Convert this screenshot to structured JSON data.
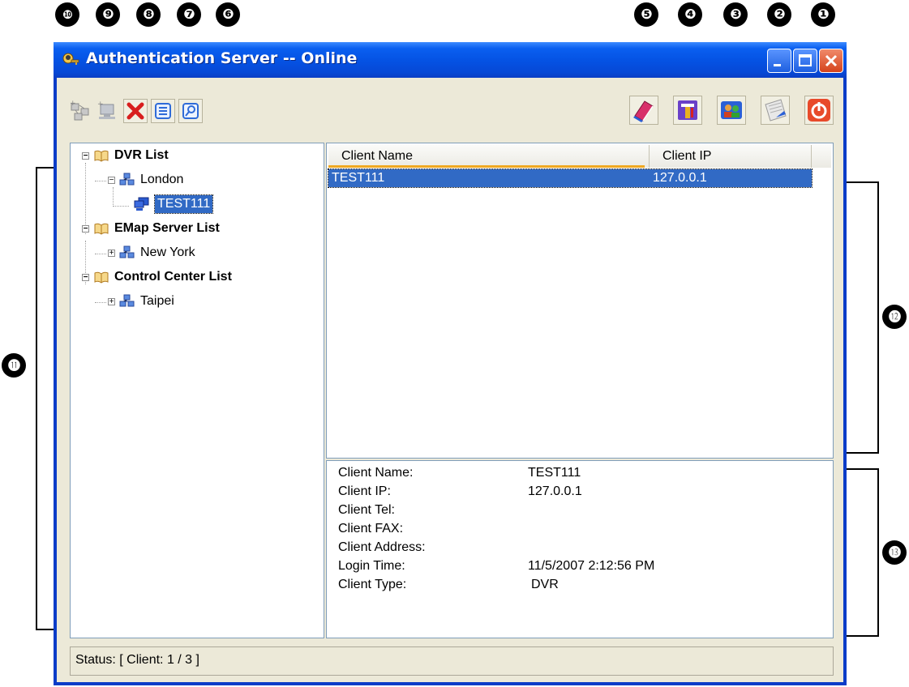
{
  "callouts": {
    "c1": "❶",
    "c2": "❷",
    "c3": "❸",
    "c4": "❹",
    "c5": "❺",
    "c6": "❻",
    "c7": "❼",
    "c8": "❽",
    "c9": "❾",
    "c10": "❿",
    "c11": "⓫",
    "c12": "⓬",
    "c13": "⓭"
  },
  "window": {
    "title": "Authentication Server -- Online",
    "controls": [
      "minimize-icon",
      "maximize-icon",
      "close-icon"
    ]
  },
  "toolbar": {
    "left_icons": [
      "add-server-icon",
      "add-client-icon",
      "delete-icon",
      "properties-icon",
      "search-icon"
    ],
    "right_icons": [
      "book-icon",
      "settings-tools-icon",
      "users-icon",
      "notepad-icon",
      "power-icon"
    ]
  },
  "tree": {
    "dvr_list": "DVR List",
    "london": "London",
    "test111": "TEST111",
    "emap_list": "EMap Server List",
    "new_york": "New York",
    "control_list": "Control Center List",
    "taipei": "Taipei"
  },
  "list": {
    "col_name": "Client Name",
    "col_ip": "Client IP",
    "rows": [
      {
        "name": "TEST111",
        "ip": "127.0.0.1"
      }
    ]
  },
  "details": {
    "labels": [
      "Client Name:",
      "Client IP:",
      "Client Tel:",
      "Client FAX:",
      "Client Address:",
      "Login Time:",
      "Client Type:"
    ],
    "values": [
      "TEST111",
      "127.0.0.1",
      "",
      "",
      "",
      "11/5/2007 2:12:56 PM",
      "DVR"
    ]
  },
  "status": {
    "text": "Status: [ Client: 1 / 3 ]"
  },
  "colors": {
    "title_bar": "#0553e4",
    "selection": "#316ac5",
    "window_bg": "#ece9d8",
    "header_accent": "#f0a820"
  }
}
